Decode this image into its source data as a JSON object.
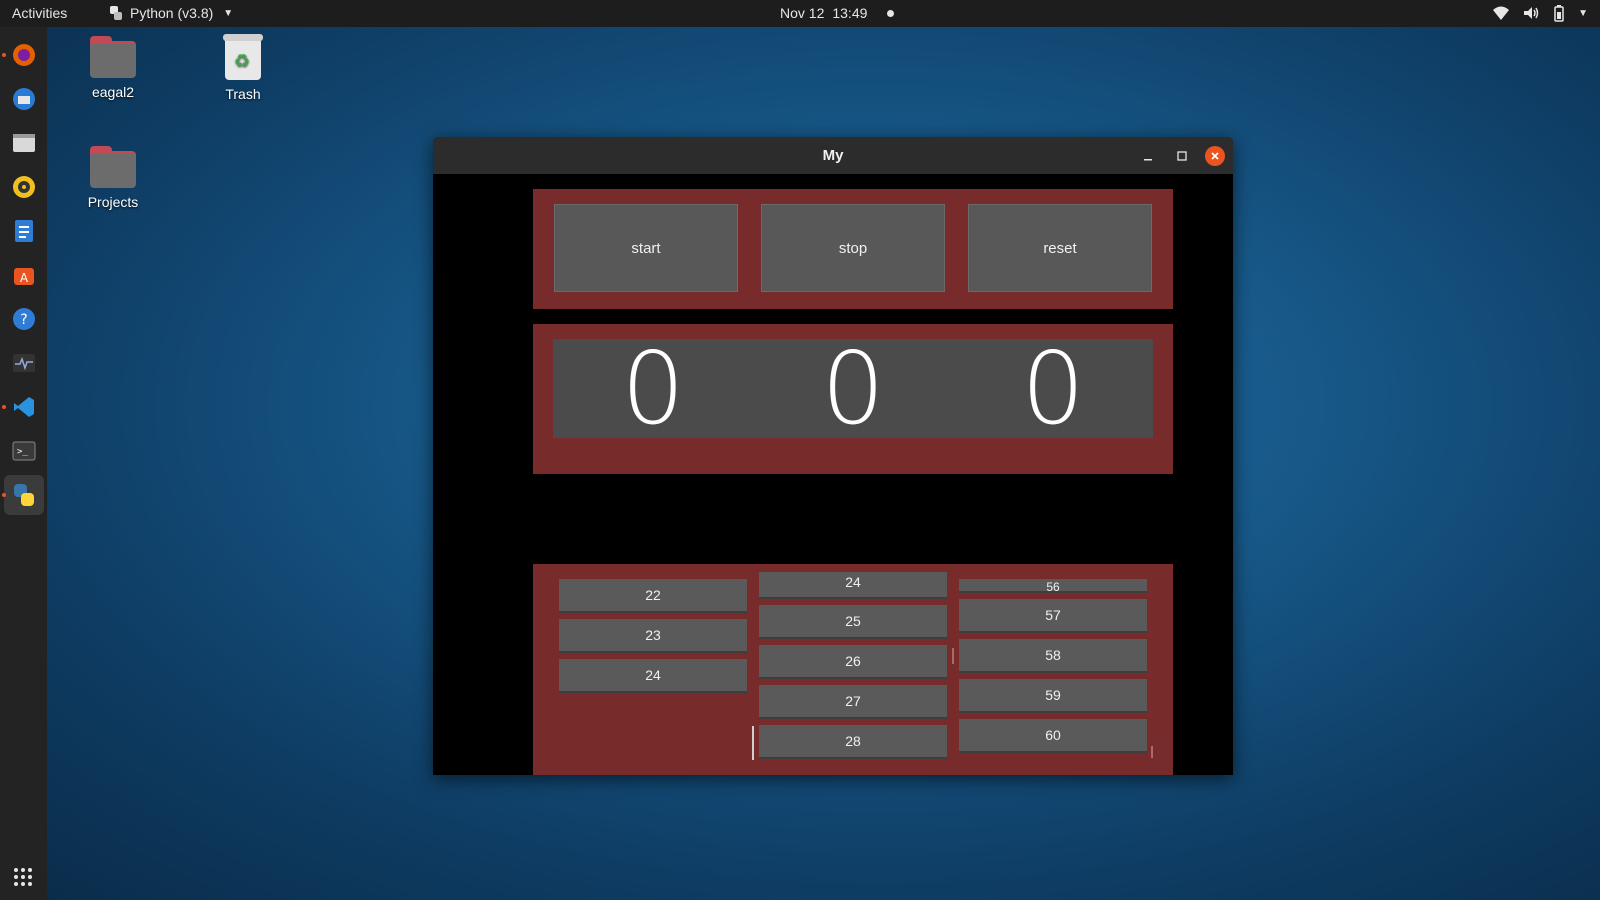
{
  "topbar": {
    "activities": "Activities",
    "app_menu": "Python (v3.8)",
    "date": "Nov 12",
    "time": "13:49"
  },
  "desktop": {
    "icons": [
      {
        "label": "eagal2"
      },
      {
        "label": "Trash"
      },
      {
        "label": "Projects"
      }
    ]
  },
  "window": {
    "title": "My",
    "buttons": {
      "start": "start",
      "stop": "stop",
      "reset": "reset"
    },
    "display": {
      "hours": "0",
      "minutes": "0",
      "seconds": "0"
    },
    "lists": {
      "col1": [
        "22",
        "23",
        "24"
      ],
      "col2": [
        "24",
        "25",
        "26",
        "27",
        "28"
      ],
      "col3": [
        "56",
        "57",
        "58",
        "59",
        "60"
      ]
    }
  },
  "colors": {
    "panel": "#782b2b",
    "button": "#585858",
    "display": "#4b4b4b",
    "accent": "#e95420"
  }
}
